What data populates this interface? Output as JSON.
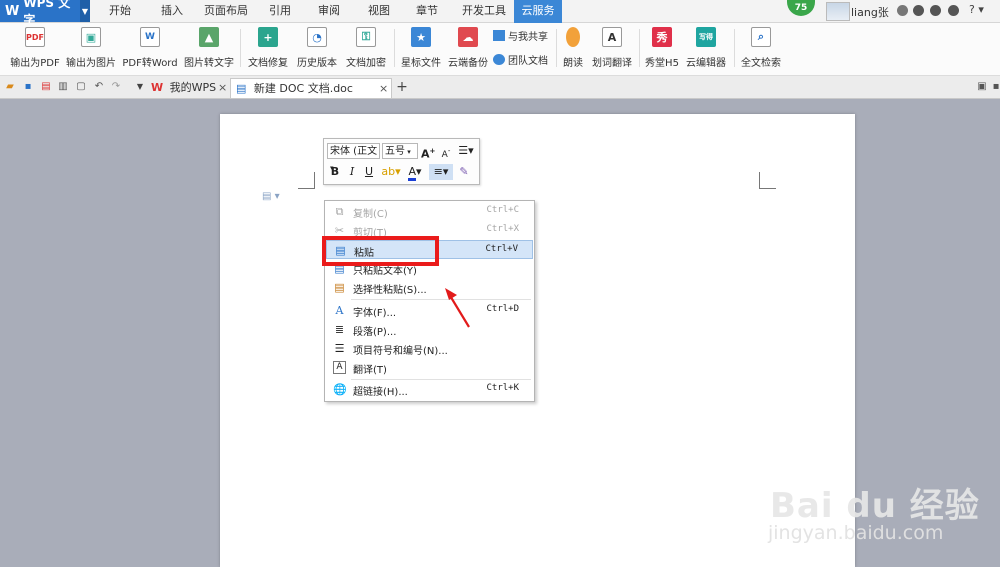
{
  "app": {
    "name": "WPS 文字",
    "logo": "W"
  },
  "menu": {
    "tabs": [
      "开始",
      "插入",
      "页面布局",
      "引用",
      "审阅",
      "视图",
      "章节",
      "开发工具",
      "云服务"
    ],
    "active_tab": "云服务"
  },
  "user": {
    "name": "liang张",
    "level_badge": "75"
  },
  "ribbon": {
    "buttons": [
      "输出为PDF",
      "输出为图片",
      "PDF转Word",
      "图片转文字",
      "文档修复",
      "历史版本",
      "文档加密",
      "星标文件",
      "云端备份",
      "朗读",
      "划词翻译",
      "秀堂H5",
      "云编辑器",
      "全文检索"
    ],
    "small_buttons": [
      "与我共享",
      "团队文档"
    ],
    "icon_text": {
      "xiu": "秀",
      "xiaode": "写得"
    }
  },
  "tabs": [
    {
      "label": "我的WPS",
      "active": false
    },
    {
      "label": "新建 DOC 文档.doc",
      "active": true
    }
  ],
  "mini_toolbar": {
    "font": "宋体 (正文",
    "size": "五号",
    "bold": "B",
    "italic": "I",
    "underline": "U",
    "grow": "A",
    "shrink": "A",
    "font_color": "A"
  },
  "context_menu": {
    "items": [
      {
        "label": "复制(C)",
        "shortcut": "Ctrl+C",
        "enabled": false,
        "icon": "copy-icon"
      },
      {
        "label": "剪切(T)",
        "shortcut": "Ctrl+X",
        "enabled": false,
        "icon": "scissors-icon"
      },
      {
        "label": "粘贴",
        "shortcut": "Ctrl+V",
        "enabled": true,
        "icon": "paste-icon",
        "highlighted": true
      },
      {
        "label": "只粘贴文本(Y)",
        "shortcut": "",
        "enabled": true,
        "icon": "paste-text-icon"
      },
      {
        "label": "选择性粘贴(S)...",
        "shortcut": "",
        "enabled": true,
        "icon": "paste-special-icon"
      },
      {
        "label": "字体(F)...",
        "shortcut": "Ctrl+D",
        "enabled": true,
        "icon": "font-icon"
      },
      {
        "label": "段落(P)...",
        "shortcut": "",
        "enabled": true,
        "icon": "paragraph-icon"
      },
      {
        "label": "项目符号和编号(N)...",
        "shortcut": "",
        "enabled": true,
        "icon": "list-icon"
      },
      {
        "label": "翻译(T)",
        "shortcut": "",
        "enabled": true,
        "icon": "translate-icon"
      },
      {
        "label": "超链接(H)...",
        "shortcut": "Ctrl+K",
        "enabled": true,
        "icon": "hyperlink-icon"
      }
    ]
  },
  "colors": {
    "accent": "#2a73c8",
    "highlight": "#d4e5f8",
    "annotation": "#ea1b1b",
    "workspace": "#a9adb9"
  },
  "watermark": {
    "main": "Bai du 经验",
    "sub": "jingyan.baidu.com"
  }
}
